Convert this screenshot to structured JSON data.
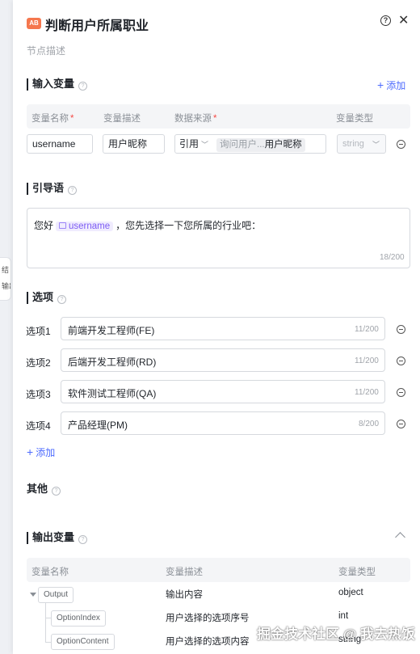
{
  "side_card": {
    "line1": "结",
    "line2": "输出"
  },
  "header": {
    "badge": "AB",
    "title": "判断用户所属职业",
    "help": "?",
    "close": "✕"
  },
  "node_description_placeholder": "节点描述",
  "input_section": {
    "title": "输入变量",
    "add_label": "添加",
    "columns": {
      "name": "变量名称",
      "desc": "变量描述",
      "source": "数据来源",
      "type": "变量类型"
    },
    "row": {
      "name": "username",
      "desc": "用户昵称",
      "source_mode": "引用",
      "source_ref_prefix": "询问用户...",
      "source_ref_value": "用户昵称",
      "type_placeholder": "string"
    }
  },
  "prompt_section": {
    "title": "引导语",
    "text_before": "您好",
    "variable": "username",
    "text_after": "，您先选择一下您所属的行业吧：",
    "counter": "18/200"
  },
  "options_section": {
    "title": "选项",
    "add_label": "添加",
    "options": [
      {
        "label": "选项1",
        "value": "前端开发工程师(FE)",
        "counter": "11/200"
      },
      {
        "label": "选项2",
        "value": "后端开发工程师(RD)",
        "counter": "11/200"
      },
      {
        "label": "选项3",
        "value": "软件测试工程师(QA)",
        "counter": "11/200"
      },
      {
        "label": "选项4",
        "value": "产品经理(PM)",
        "counter": "8/200"
      }
    ]
  },
  "other_section": {
    "title": "其他"
  },
  "output_section": {
    "title": "输出变量",
    "columns": {
      "name": "变量名称",
      "desc": "变量描述",
      "type": "变量类型"
    },
    "rows": [
      {
        "name": "Output",
        "desc": "输出内容",
        "type": "object"
      },
      {
        "name": "OptionIndex",
        "desc": "用户选择的选项序号",
        "type": "int"
      },
      {
        "name": "OptionContent",
        "desc": "用户选择的选项内容",
        "type": "string"
      }
    ]
  },
  "watermark": "掘金技术社区 @ 我去热饭"
}
